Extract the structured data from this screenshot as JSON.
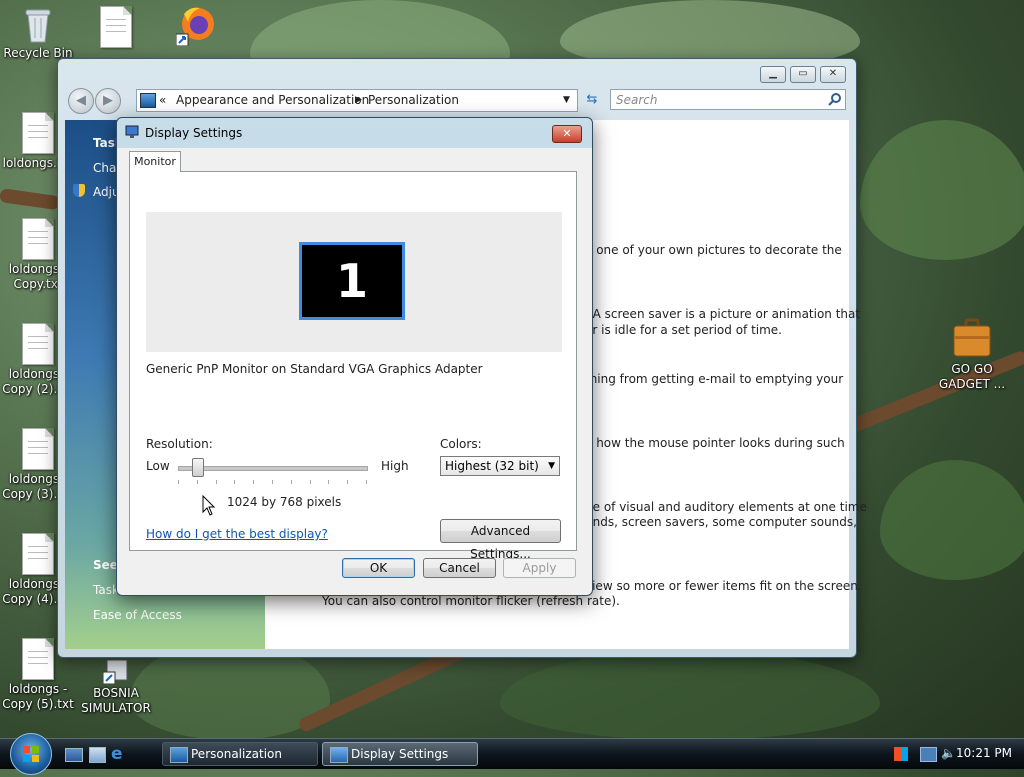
{
  "desktop": {
    "icons": [
      {
        "label": "Recycle Bin"
      },
      {
        "label": "loldongs.txt"
      },
      {
        "label": "loldongs - Copy.txt"
      },
      {
        "label": "loldongs - Copy (2).txt"
      },
      {
        "label": "loldongs - Copy (3).txt"
      },
      {
        "label": "loldongs - Copy (4).txt"
      },
      {
        "label": "loldongs - Copy (5).txt"
      },
      {
        "label": "BOSNIA SIMULATOR"
      },
      {
        "label": "GO GO GADGET ..."
      }
    ]
  },
  "control_panel": {
    "breadcrumb": [
      "Appearance and Personalization",
      "Personalization"
    ],
    "search_placeholder": "Search",
    "sidebar": {
      "tasks_heading": "Tasks",
      "task_links": [
        "Change desktop icons",
        "Adjust font size (DPI)"
      ],
      "see_also_heading": "See also",
      "see_also_links": [
        "Taskbar and Start Menu",
        "Ease of Access"
      ]
    },
    "content_lines": [
      "e one of your own pictures to decorate the",
      ". A screen saver is a picture or animation that",
      "er is idle for a set period of time.",
      "thing from getting e-mail to emptying your",
      "e how the mouse pointer looks during such",
      "ge of visual and auditory elements at one time",
      "unds, screen savers, some computer sounds,",
      "view so more or fewer items fit on the screen.",
      "You can also control monitor flicker (refresh rate)."
    ]
  },
  "display_settings": {
    "title": "Display Settings",
    "tab": "Monitor",
    "monitor_number": "1",
    "monitor_description": "Generic PnP Monitor on Standard VGA Graphics Adapter",
    "resolution_label": "Resolution:",
    "low_label": "Low",
    "high_label": "High",
    "resolution_value": "1024 by 768 pixels",
    "resolution_slider_level": 0.1,
    "colors_label": "Colors:",
    "colors_value": "Highest (32 bit)",
    "help_link": "How do I get the best display?",
    "advanced_button": "Advanced Settings...",
    "ok_button": "OK",
    "cancel_button": "Cancel",
    "apply_button": "Apply"
  },
  "taskbar": {
    "tasks": [
      {
        "label": "Personalization"
      },
      {
        "label": "Display Settings"
      }
    ],
    "clock": "10:21 PM"
  }
}
